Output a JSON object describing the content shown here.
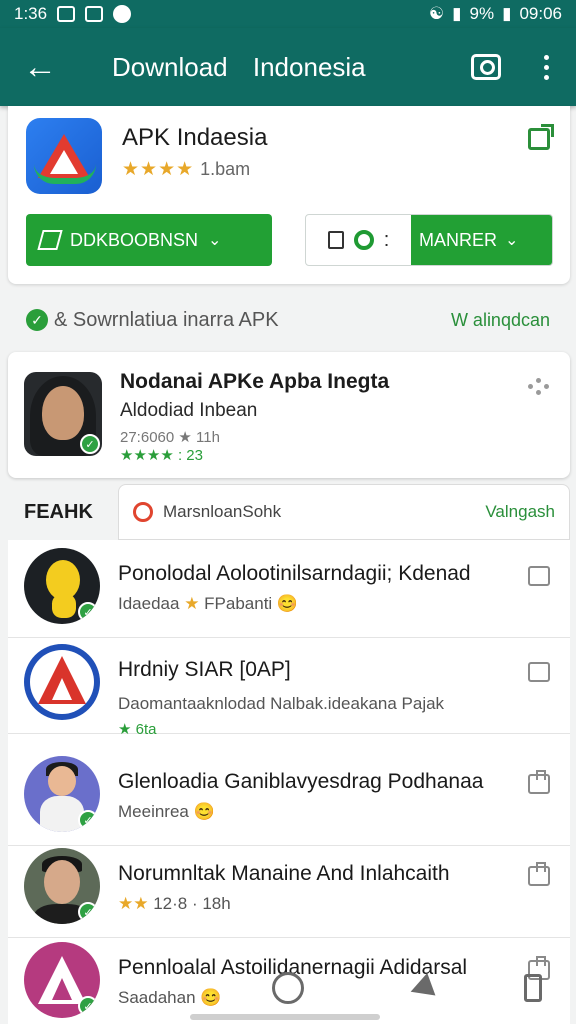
{
  "status": {
    "time_left": "1:36",
    "battery": "9%",
    "time_right": "09:06"
  },
  "appbar": {
    "title_a": "Download",
    "title_b": "Indonesia"
  },
  "app": {
    "name": "APK Indaesia",
    "rating_text": "1.bam",
    "download_label": "DDKBOOBNSN",
    "manager_label": "MANRER"
  },
  "section": {
    "text": "& Sowrnlatiua inarra APK",
    "link": "W alinqdcan"
  },
  "featured": {
    "title": "Nodanai APKe Apba Inegta",
    "subtitle": "Aldodiad Inbean",
    "meta": "27:6060 ★ 11h",
    "stars": "★★★★ : 23"
  },
  "tabs": {
    "label": "FEAHK",
    "pill_text": "MarsnloanSohk",
    "pill_link": "Valngash"
  },
  "list": [
    {
      "title": "Ponolodal Aolootinilsarndagii; Kdenad",
      "sub_a": "Idaedaa",
      "sub_star": "★",
      "sub_b": "FPabanti 😊"
    },
    {
      "title": "Hrdniy SIAR [0AP]",
      "sub_a": "Daomantaaknlodad Nalbak.ideakana Pajak",
      "sub_star": "★",
      "sub_b": "6ta"
    },
    {
      "title": "Glenloadia Ganiblavyesdrag Podhanaa",
      "sub_a": "Meeinrea",
      "sub_star": "",
      "sub_b": "😊"
    },
    {
      "title": "Norumnltak Manaine And Inlahcaith",
      "sub_a": "",
      "sub_star": "★★",
      "sub_b": "12·8 · 18h"
    },
    {
      "title": "Pennloalal Astoilidanernagii Adidarsal",
      "sub_a": "Saadahan",
      "sub_star": "",
      "sub_b": "😊"
    }
  ],
  "colors": {
    "appbar": "#0f6b62",
    "accent_green": "#22a034",
    "star": "#e8a82a"
  }
}
